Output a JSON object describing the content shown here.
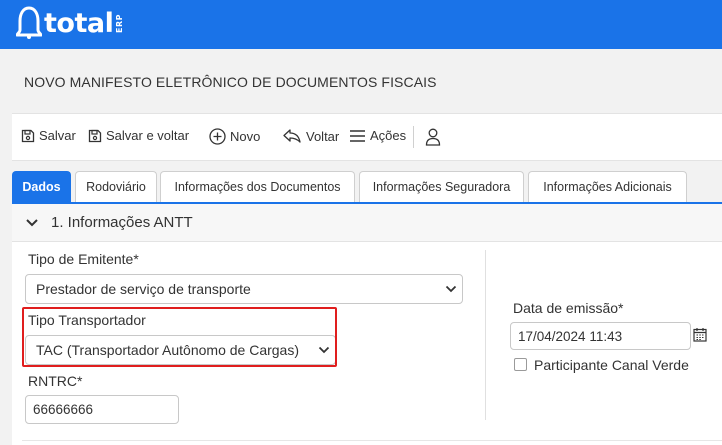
{
  "brand": {
    "logo_word": "total",
    "logo_suffix": "ERP",
    "bar_color": "#1a73e8"
  },
  "page": {
    "title": "NOVO MANIFESTO ELETRÔNICO DE DOCUMENTOS FISCAIS"
  },
  "toolbar": {
    "save_label": "Salvar",
    "save_back_label": "Salvar e voltar",
    "new_label": "Novo",
    "back_label": "Voltar",
    "actions_label": "Ações"
  },
  "tabs": [
    {
      "label": "Dados",
      "active": true
    },
    {
      "label": "Rodoviário"
    },
    {
      "label": "Informações dos Documentos"
    },
    {
      "label": "Informações Seguradora"
    },
    {
      "label": "Informações Adicionais"
    }
  ],
  "section": {
    "title": "1. Informações ANTT"
  },
  "form": {
    "emitente_label": "Tipo de Emitente*",
    "emitente_value": "Prestador de serviço de transporte",
    "transportador_label": "Tipo Transportador",
    "transportador_value": "TAC (Transportador Autônomo de Cargas)",
    "rntrc_label": "RNTRC*",
    "rntrc_value": "66666666",
    "data_emissao_label": "Data de emissão*",
    "data_emissao_value": "17/04/2024 11:43",
    "canal_verde_label": "Participante Canal Verde",
    "canal_verde_checked": false
  },
  "colors": {
    "accent": "#1a73e8",
    "highlight": "#e01e1e"
  }
}
